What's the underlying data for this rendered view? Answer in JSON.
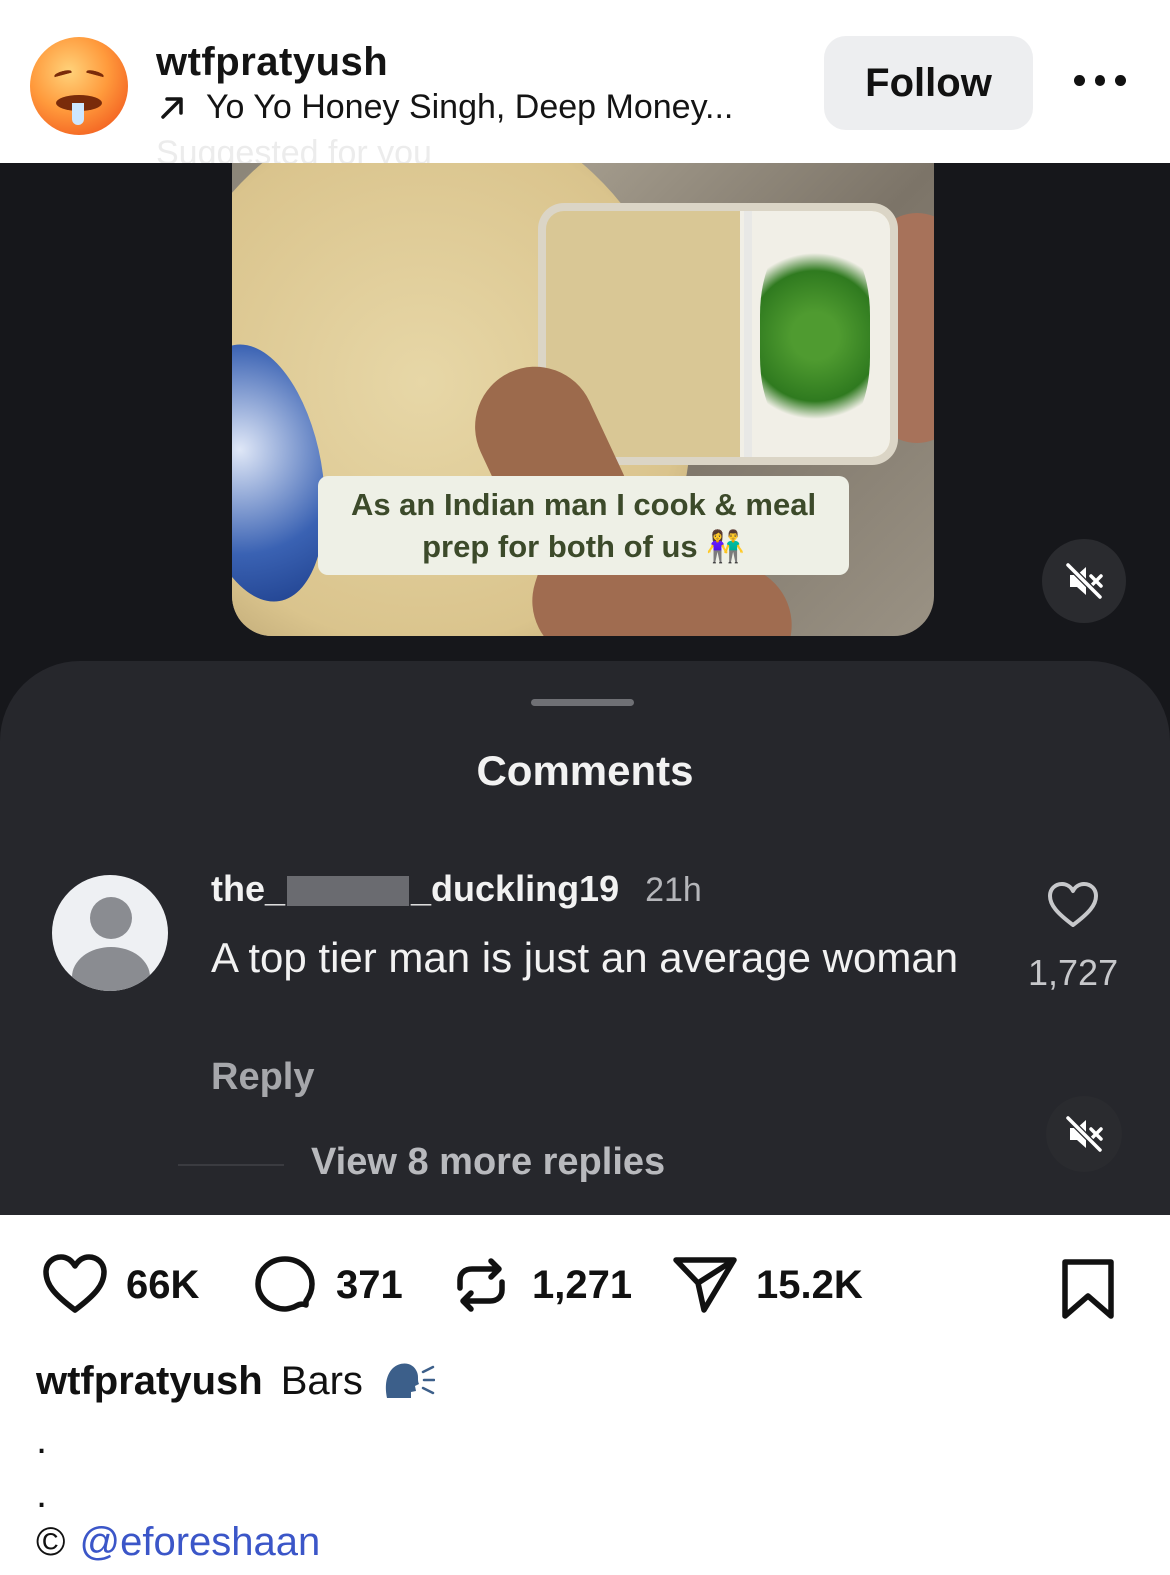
{
  "header": {
    "username": "wtfpratyush",
    "music": "Yo Yo Honey Singh, Deep Money...",
    "suggested": "Suggested for you",
    "follow_label": "Follow"
  },
  "video": {
    "overlay_text_line1": "As an Indian man I cook & meal",
    "overlay_text_line2": "prep for both of us 👫"
  },
  "comments": {
    "title": "Comments",
    "items": [
      {
        "user_prefix": "the_",
        "user_suffix": "_duckling19",
        "time": "21h",
        "text": "A top tier man is just an average woman",
        "reply_label": "Reply",
        "likes": "1,727"
      }
    ],
    "view_replies": "View 8 more replies"
  },
  "actions": {
    "likes": "66K",
    "comments": "371",
    "reposts": "1,271",
    "shares": "15.2K"
  },
  "caption": {
    "username": "wtfpratyush",
    "text": "Bars",
    "dot1": ".",
    "dot2": ".",
    "credit_symbol": "©",
    "credit_handle": "@eforeshaan"
  },
  "colors": {
    "sheet_bg": "#26272c",
    "media_bg": "#16171b",
    "link": "#3b56c8"
  }
}
